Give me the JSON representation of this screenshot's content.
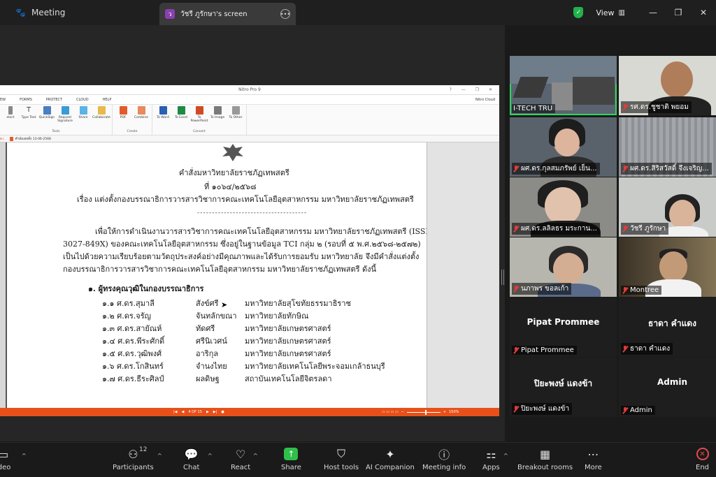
{
  "topbar": {
    "meeting_label": "Meeting",
    "screen_tab_badge": "ว",
    "screen_tab_label": "วัชรี ภูรักษา's screen",
    "view_label": "View"
  },
  "nitro": {
    "title": "Nitro Pro 9",
    "menu": [
      "EW",
      "FORMS",
      "PROTECT",
      "CLOUD",
      "HELP"
    ],
    "cloud_user": "Nitro Cloud",
    "ribbon_groups": [
      {
        "label": "Tools",
        "items": [
          "elect",
          "Type Text",
          "QuickSign",
          "Request Signature",
          "Share",
          "Collaborate"
        ]
      },
      {
        "label": "Create",
        "items": [
          "PDF",
          "Combine"
        ]
      },
      {
        "label": "Convert",
        "items": [
          "To Word",
          "To Excel",
          "To PowerPoint",
          "To Image",
          "To Other"
        ]
      }
    ],
    "doc_tab_left": "อ เ",
    "doc_tab": "คำสั่งแต่งตั้ง 13-06-2568",
    "page_indicator": "4 OF 15",
    "zoom": "150%"
  },
  "document": {
    "heading": "คำสั่งมหาวิทยาลัยราชภัฏเทพสตรี",
    "number": "ที่ ๑๐๖๔/๒๕๖๘",
    "subject": "เรื่อง  แต่งตั้งกองบรรณาธิการวารสารวิชาการคณะเทคโนโลยีอุตสาหกรรม มหาวิทยาลัยราชภัฏเทพสตรี",
    "dashes": "-------------------------------------",
    "para": [
      "เพื่อให้การดำเนินงานวารสารวิชาการคณะเทคโนโลยีอุตสาหกรรม มหาวิทยาลัยราชภัฏเทพสตรี (ISSN",
      "3027-849X) ของคณะเทคโนโลยีอุตสาหกรรม ซึ่งอยู่ในฐานข้อมูล TCI กลุ่ม ๒ (รอบที่ ๕ พ.ศ.๒๕๖๘-๒๕๗๒)",
      "เป็นไปด้วยความเรียบร้อยตามวัตถุประสงค์อย่างมีคุณภาพและได้รับการยอมรับ มหาวิทยาลัย จึงมีคำสั่งแต่งตั้ง",
      "กองบรรณาธิการวารสารวิชาการคณะเทคโนโลยีอุตสาหกรรม มหาวิทยาลัยราชภัฏเทพสตรี ดังนี้"
    ],
    "section": "๑. ผู้ทรงคุณวุฒิในกองบรรณาธิการ",
    "rows": [
      {
        "no": "๑.๑ ศ.ดร.สุมาลี",
        "last": "สังข์ศรี",
        "org": "มหาวิทยาลัยสุโขทัยธรรมาธิราช"
      },
      {
        "no": "๑.๒ ศ.ดร.จรัญ",
        "last": "จันทลักขณา",
        "org": "มหาวิทยาลัยทักษิณ"
      },
      {
        "no": "๑.๓ ศ.ดร.สายัณห์",
        "last": "ทัดศรี",
        "org": "มหาวิทยาลัยเกษตรศาสตร์"
      },
      {
        "no": "๑.๔ ศ.ดร.พีระศักดิ์",
        "last": "ศรีนิเวศน์",
        "org": "มหาวิทยาลัยเกษตรศาสตร์"
      },
      {
        "no": "๑.๕ ศ.ดร.วุฒิพงศ์",
        "last": "อาริกุล",
        "org": "มหาวิทยาลัยเกษตรศาสตร์"
      },
      {
        "no": "๑.๖ ศ.ดร.โกสินทร์",
        "last": "จำนงไทย",
        "org": "มหาวิทยาลัยเทคโนโลยีพระจอมเกล้าธนบุรี"
      },
      {
        "no": "๑.๗ ศ.ดร.ธีระศิลป์",
        "last": "ผลดิษฐ",
        "org": "สถาบันเทคโนโลยีจิตรลดา"
      }
    ]
  },
  "participants": [
    {
      "name": "I-TECH TRU",
      "muted": false
    },
    {
      "name": "รศ.ดร.ชูชาติ  พยอม",
      "muted": true
    },
    {
      "name": "ผศ.ดร.กุลสมภรัพย์ เย็น...",
      "muted": true
    },
    {
      "name": "ผศ.ดร.สิริสวัสดิ์ จึงเจริญ...",
      "muted": true
    },
    {
      "name": "ผศ.ดร.ลลิลธร มระกาน...",
      "muted": true
    },
    {
      "name": "วัชรี  ภูรักษา",
      "muted": true
    },
    {
      "name": "นภาพร  ขอลเก้า",
      "muted": true
    },
    {
      "name": "Montree",
      "muted": true
    },
    {
      "name": "Pipat Prommee",
      "display": "Pipat Prommee",
      "muted": true
    },
    {
      "name": "ธาดา  คำแดง",
      "display": "ธาดา  คำแดง",
      "muted": true
    },
    {
      "name": "ปิยะพงษ์  แดงข้า",
      "display": "ปิยะพงษ์  แดงข้า",
      "muted": true
    },
    {
      "name": "Admin",
      "display": "Admin",
      "muted": true
    }
  ],
  "toolbar": {
    "video": "ideo",
    "participants": "Participants",
    "participants_count": "12",
    "chat": "Chat",
    "react": "React",
    "share": "Share",
    "host_tools": "Host tools",
    "ai_companion": "AI Companion",
    "meeting_info": "Meeting info",
    "apps": "Apps",
    "breakout_rooms": "Breakout rooms",
    "more": "More",
    "end": "End"
  },
  "colors": {
    "active_speaker": "#2fd65c",
    "share_green": "#2fbf4a",
    "nitro_orange": "#e8501a",
    "end_red": "#e14b4b"
  }
}
